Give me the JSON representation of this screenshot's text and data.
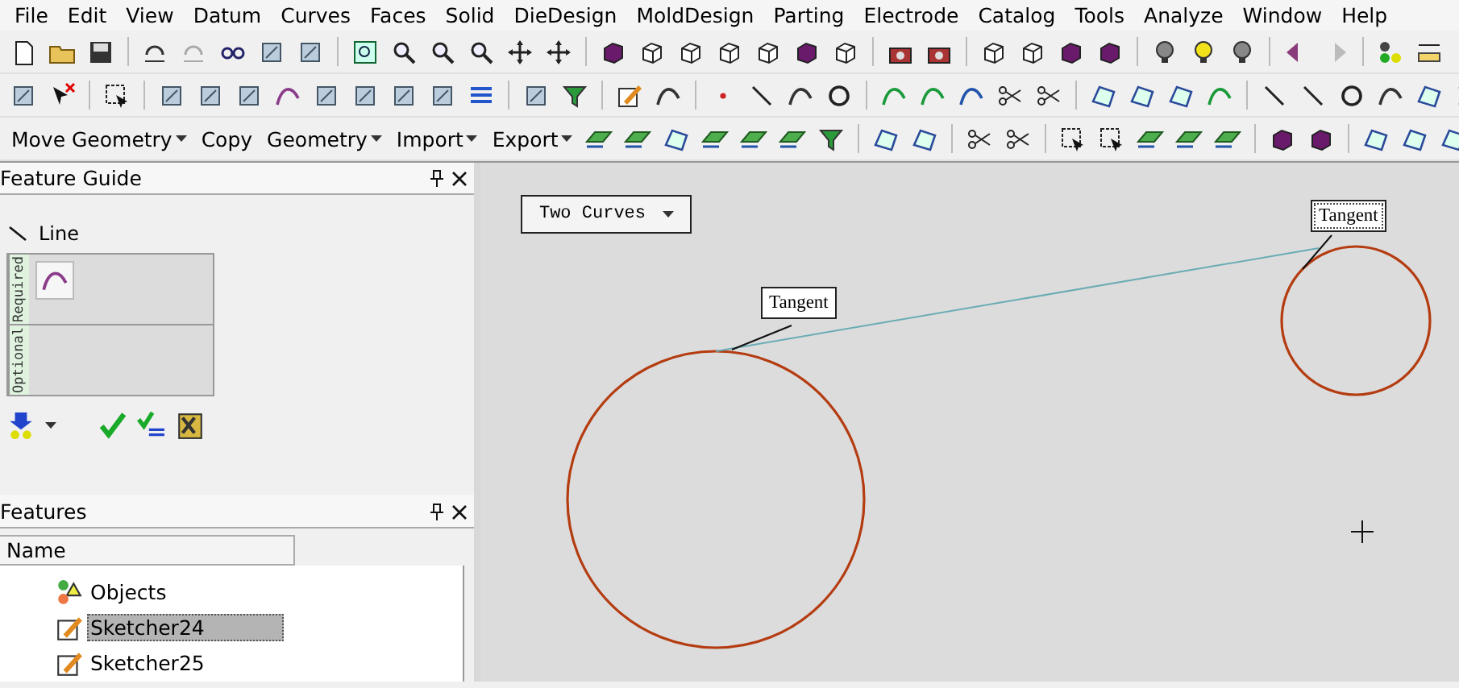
{
  "menu": [
    "File",
    "Edit",
    "View",
    "Datum",
    "Curves",
    "Faces",
    "Solid",
    "DieDesign",
    "MoldDesign",
    "Parting",
    "Electrode",
    "Catalog",
    "Tools",
    "Analyze",
    "Window",
    "Help"
  ],
  "text_toolbar": [
    {
      "label": "Move Geometry",
      "dropdown": true
    },
    {
      "label": "Copy",
      "dropdown": false
    },
    {
      "label": "Geometry",
      "dropdown": true
    },
    {
      "label": "Import",
      "dropdown": true
    },
    {
      "label": "Export",
      "dropdown": true
    }
  ],
  "feature_guide": {
    "title": "Feature Guide",
    "step": "Line",
    "sections": [
      {
        "label": "Required",
        "has_input": true
      },
      {
        "label": "Optional",
        "has_input": false
      }
    ]
  },
  "features": {
    "title": "Features",
    "column": "Name",
    "items": [
      {
        "label": "Objects",
        "selected": false
      },
      {
        "label": "Sketcher24",
        "selected": true
      },
      {
        "label": "Sketcher25",
        "selected": false
      }
    ]
  },
  "canvas": {
    "mode": "Two Curves",
    "tangent_labels": [
      "Tangent",
      "Tangent"
    ]
  }
}
